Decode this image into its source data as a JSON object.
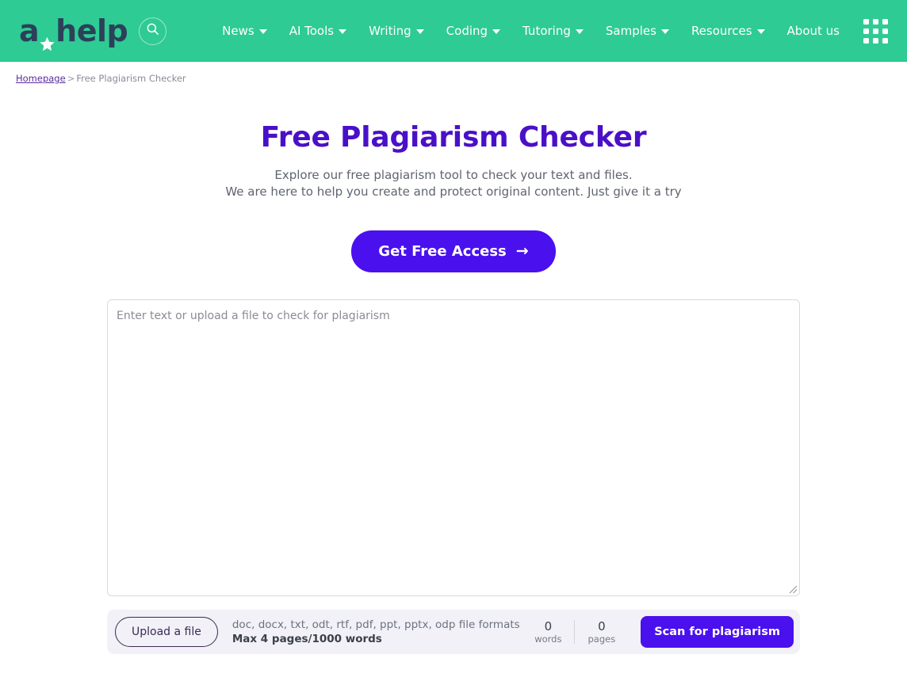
{
  "header": {
    "logo": {
      "text_before": "a",
      "icon": "star-icon",
      "text_after": "help"
    },
    "search_icon": "search-icon",
    "apps_icon": "grid-apps-icon",
    "brand_color": "#2ECB94",
    "logo_color": "#2C4059",
    "nav": [
      {
        "label": "News",
        "has_dropdown": true
      },
      {
        "label": "AI Tools",
        "has_dropdown": true
      },
      {
        "label": "Writing",
        "has_dropdown": true
      },
      {
        "label": "Coding",
        "has_dropdown": true
      },
      {
        "label": "Tutoring",
        "has_dropdown": true
      },
      {
        "label": "Samples",
        "has_dropdown": true
      },
      {
        "label": "Resources",
        "has_dropdown": true
      },
      {
        "label": "About us",
        "has_dropdown": false
      }
    ]
  },
  "breadcrumb": {
    "home_label": "Homepage",
    "separator": ">",
    "current_label": "Free Plagiarism Checker"
  },
  "hero": {
    "title": "Free Plagiarism Checker",
    "title_color": "#4A10C8",
    "subtitle_line1": "Explore our free plagiarism tool to check your text and files.",
    "subtitle_line2": "We are here to help you create and protect original content. Just give it a try",
    "cta_label": "Get Free Access",
    "cta_arrow": "→",
    "cta_color": "#4A10EE"
  },
  "editor": {
    "placeholder": "Enter text or upload a file to check for plagiarism",
    "value": "",
    "resize_handle": "resize-handle-icon"
  },
  "toolbar": {
    "upload_label": "Upload a file",
    "formats_text": "doc, docx, txt, odt, rtf, pdf, ppt, pptx, odp file formats",
    "max_text": "Max 4 pages/1000 words",
    "words_count": "0",
    "words_label": "words",
    "pages_count": "0",
    "pages_label": "pages",
    "scan_label": "Scan for plagiarism",
    "scan_color": "#4A10EE",
    "background_color": "#F1F1F7"
  }
}
